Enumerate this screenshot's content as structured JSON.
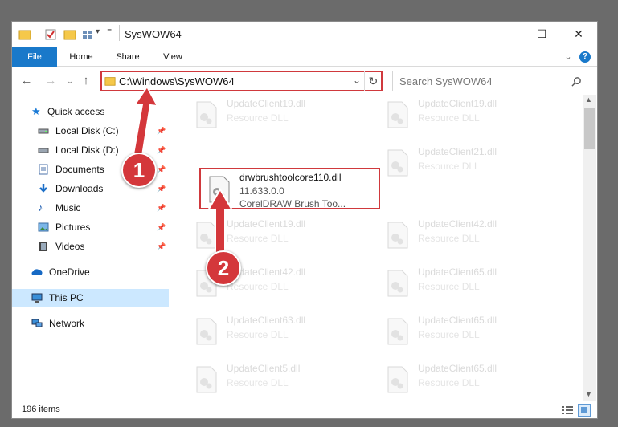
{
  "window": {
    "title": "SysWOW64",
    "minimize": "—",
    "maximize": "☐",
    "close": "✕"
  },
  "ribbon": {
    "tabs": [
      "File",
      "Home",
      "Share",
      "View"
    ],
    "expand": "⌄",
    "help": "?"
  },
  "address": {
    "path": "C:\\Windows\\SysWOW64",
    "dropdown": "⌄",
    "refresh": "↻"
  },
  "search": {
    "placeholder": "Search SysWOW64"
  },
  "sidebar": {
    "quick_access": "Quick access",
    "items": [
      {
        "label": "Local Disk (C:)",
        "icon": "drive-icon",
        "pinned": true
      },
      {
        "label": "Local Disk (D:)",
        "icon": "drive-icon",
        "pinned": true
      },
      {
        "label": "Documents",
        "icon": "documents-icon",
        "pinned": true
      },
      {
        "label": "Downloads",
        "icon": "downloads-icon",
        "pinned": true
      },
      {
        "label": "Music",
        "icon": "music-icon",
        "pinned": true
      },
      {
        "label": "Pictures",
        "icon": "pictures-icon",
        "pinned": true
      },
      {
        "label": "Videos",
        "icon": "videos-icon",
        "pinned": true
      }
    ],
    "onedrive": "OneDrive",
    "thispc": "This PC",
    "network": "Network"
  },
  "files": {
    "left": [
      {
        "name": "UpdateClient19.dll",
        "type": "Resource DLL"
      },
      {
        "name": "drwbrushtoolcore110.dll",
        "version": "11.633.0.0",
        "type": "CorelDRAW Brush Too...",
        "highlight": true
      },
      {
        "name": "UpdateClient19.dll",
        "type": "Resource DLL"
      },
      {
        "name": "UpdateClient42.dll",
        "type": "Resource DLL"
      },
      {
        "name": "UpdateClient63.dll",
        "type": "Resource DLL"
      },
      {
        "name": "UpdateClient5.dll",
        "type": "Resource DLL"
      }
    ],
    "right": [
      {
        "name": "UpdateClient19.dll",
        "type": "Resource DLL"
      },
      {
        "name": "UpdateClient21.dll",
        "type": "Resource DLL"
      },
      {
        "name": "UpdateClient42.dll",
        "type": "Resource DLL"
      },
      {
        "name": "UpdateClient65.dll",
        "type": "Resource DLL"
      },
      {
        "name": "UpdateClient65.dll",
        "type": "Resource DLL"
      },
      {
        "name": "UpdateClient65.dll",
        "type": "Resource DLL"
      }
    ]
  },
  "status": {
    "items": "196 items"
  },
  "annotations": {
    "step1": "1",
    "step2": "2",
    "color": "#d4373b"
  }
}
